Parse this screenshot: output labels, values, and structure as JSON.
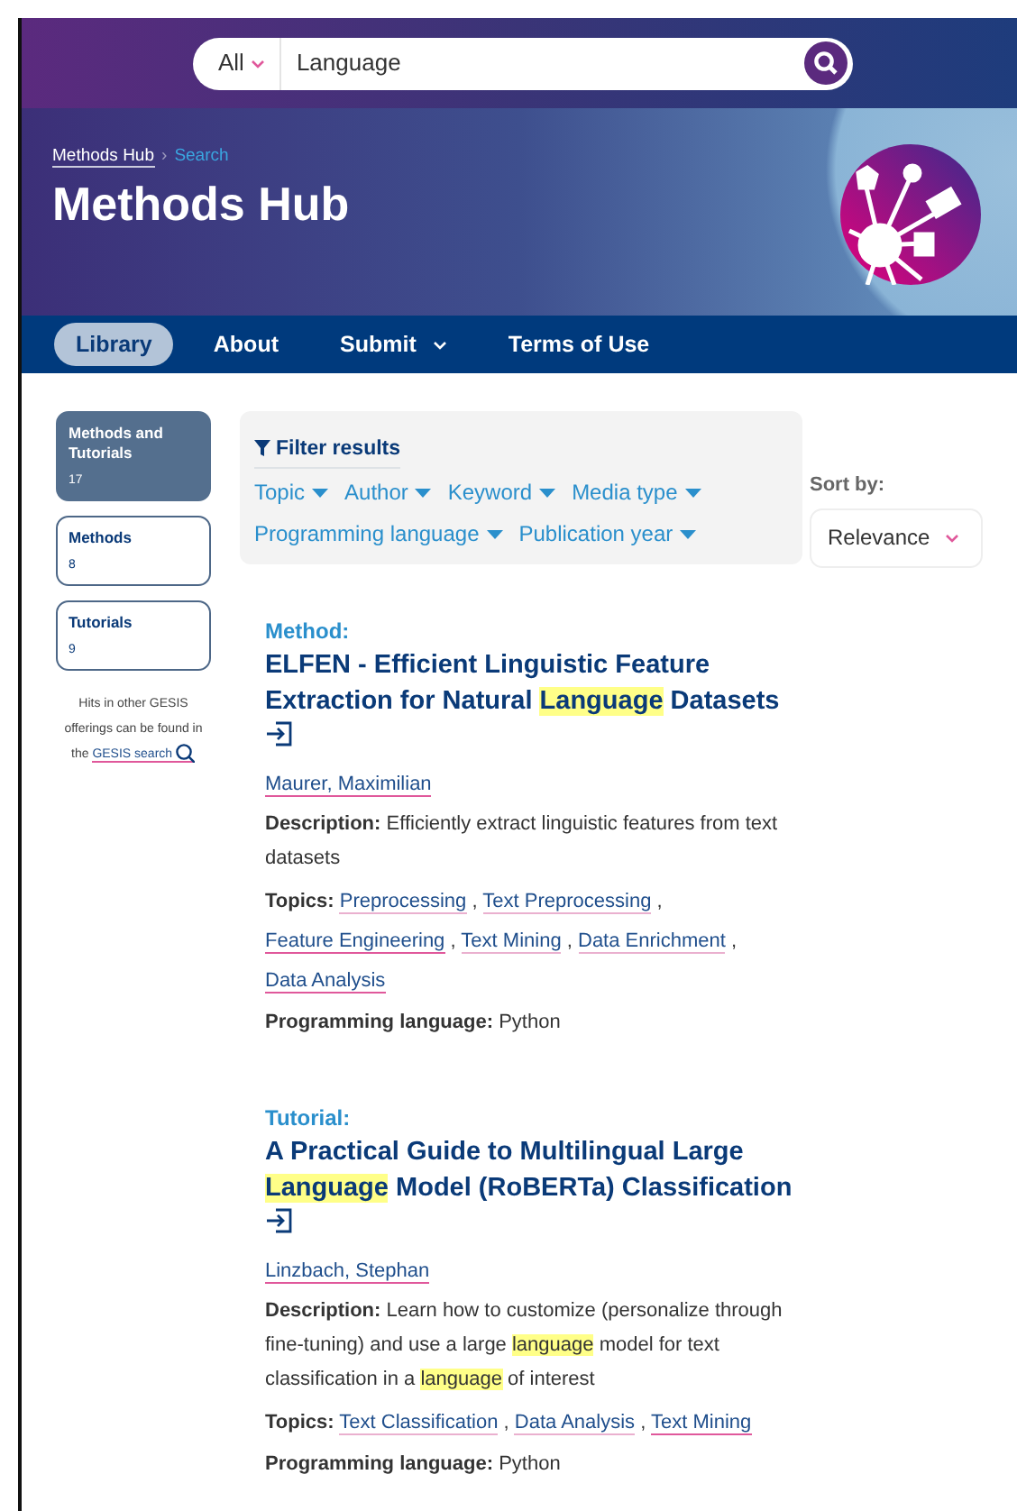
{
  "search": {
    "scope": "All",
    "value": "Language"
  },
  "breadcrumb": [
    {
      "label": "Methods Hub",
      "current": false
    },
    {
      "label": "Search",
      "current": true
    }
  ],
  "breadcrumb_separator": "›",
  "title": "Methods Hub",
  "nav": [
    {
      "label": "Library",
      "selected": true,
      "dropdown": false
    },
    {
      "label": "About",
      "selected": false,
      "dropdown": false
    },
    {
      "label": "Submit",
      "selected": false,
      "dropdown": true
    },
    {
      "label": "Terms of Use",
      "selected": false,
      "dropdown": false
    }
  ],
  "categories": [
    {
      "label": "Methods and Tutorials",
      "count": "17",
      "selected": true
    },
    {
      "label": "Methods",
      "count": "8",
      "selected": false
    },
    {
      "label": "Tutorials",
      "count": "9",
      "selected": false
    }
  ],
  "other_hits": {
    "text": "Hits in other GESIS offerings can be found in the",
    "link": "GESIS search"
  },
  "filters": {
    "title": "Filter results",
    "items": [
      "Topic",
      "Author",
      "Keyword",
      "Media type",
      "Programming language",
      "Publication year"
    ]
  },
  "sort": {
    "label": "Sort by:",
    "value": "Relevance"
  },
  "results": [
    {
      "type": "Method:",
      "title": [
        {
          "text": "ELFEN - Efficient Linguistic Feature Extraction for Natural ",
          "highlighted": false
        },
        {
          "text": "Language",
          "highlighted": true
        },
        {
          "text": " Datasets",
          "highlighted": false
        }
      ],
      "author": "Maurer, Maximilian",
      "description_label": "Description:",
      "description": [
        {
          "text": "Efficiently extract linguistic features from text datasets",
          "highlighted": false
        }
      ],
      "topics_label": "Topics:",
      "topics": [
        "Preprocessing",
        "Text Preprocessing",
        "Feature Engineering",
        "Text Mining",
        "Data Enrichment",
        "Data Analysis"
      ],
      "language_label": "Programming language:",
      "language": "Python"
    },
    {
      "type": "Tutorial:",
      "title": [
        {
          "text": "A Practical Guide to Multilingual Large ",
          "highlighted": false
        },
        {
          "text": "Language",
          "highlighted": true
        },
        {
          "text": " Model (RoBERTa) Classification",
          "highlighted": false
        }
      ],
      "author": "Linzbach, Stephan",
      "description_label": "Description:",
      "description": [
        {
          "text": "Learn how to customize (personalize through fine-tuning) and use a large ",
          "highlighted": false
        },
        {
          "text": "language",
          "highlighted": true
        },
        {
          "text": " model for text classification in a ",
          "highlighted": false
        },
        {
          "text": "language",
          "highlighted": true
        },
        {
          "text": " of interest",
          "highlighted": false
        }
      ],
      "topics_label": "Topics:",
      "topics": [
        "Text Classification",
        "Data Analysis",
        "Text Mining"
      ],
      "language_label": "Programming language:",
      "language": "Python"
    }
  ],
  "topic_separator": ","
}
